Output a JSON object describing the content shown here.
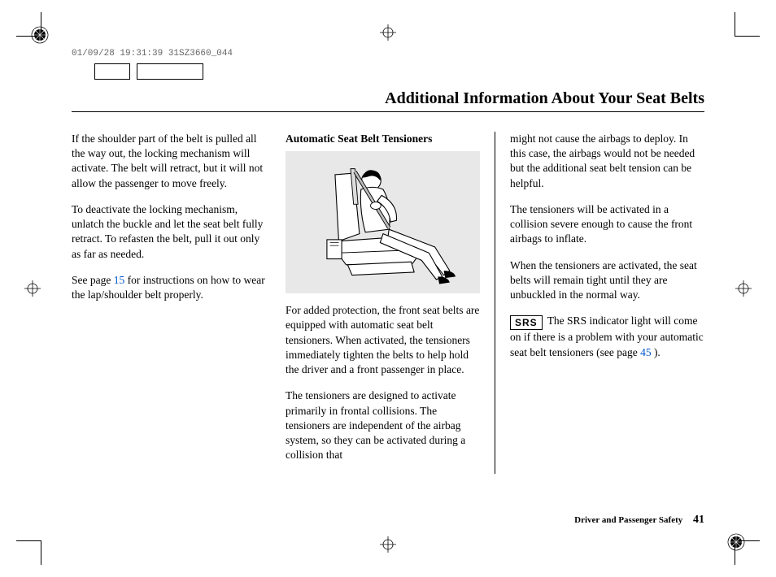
{
  "timestamp": "01/09/28 19:31:39 31SZ3660_044",
  "title": "Additional Information About Your Seat Belts",
  "col1": {
    "p1": "If the shoulder part of the belt is pulled all the way out, the locking mechanism will activate. The belt will retract, but it will not allow the passenger to move freely.",
    "p2": "To deactivate the locking mechanism, unlatch the buckle and let the seat belt fully retract. To refasten the belt, pull it out only as far as needed.",
    "p3a": "See page ",
    "p3link": "15",
    "p3b": " for instructions on how to wear the lap/shoulder belt properly."
  },
  "col2": {
    "subhead": "Automatic Seat Belt Tensioners",
    "p1": "For added protection, the front seat belts are equipped with automatic seat belt tensioners. When activated, the tensioners immediately tighten the belts to help hold the driver and a front passenger in place.",
    "p2": "The tensioners are designed to activate primarily in frontal collisions. The tensioners are independent of the airbag system, so they can be activated during a collision that"
  },
  "col3": {
    "p1": "might not cause the airbags to deploy. In this case, the airbags would not be needed but the additional seat belt tension can be helpful.",
    "p2": "The tensioners will be activated in a collision severe enough to cause the front airbags to inflate.",
    "p3": "When the tensioners are activated, the seat belts will remain tight until they are unbuckled in the normal way.",
    "srs_label": "SRS",
    "p4a": "The SRS indicator light will come on if there is a problem with your automatic seat belt tensioners (see page ",
    "p4link": "45",
    "p4b": " )."
  },
  "footer": {
    "section": "Driver and Passenger Safety",
    "page": "41"
  }
}
